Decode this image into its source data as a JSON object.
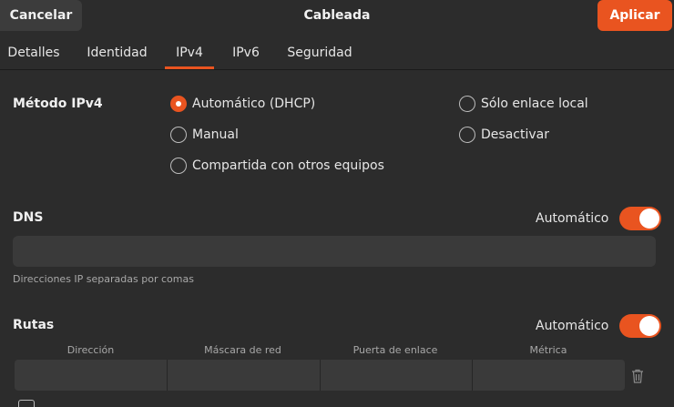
{
  "header": {
    "title": "Cableada",
    "cancel_label": "Cancelar",
    "apply_label": "Aplicar"
  },
  "tabs": [
    {
      "label": "Detalles"
    },
    {
      "label": "Identidad"
    },
    {
      "label": "IPv4"
    },
    {
      "label": "IPv6"
    },
    {
      "label": "Seguridad"
    }
  ],
  "active_tab": "IPv4",
  "ipv4": {
    "method_label": "Método IPv4",
    "methods": [
      {
        "label": "Automático (DHCP)",
        "selected": true
      },
      {
        "label": "Manual",
        "selected": false
      },
      {
        "label": "Compartida con otros equipos",
        "selected": false
      },
      {
        "label": "Sólo enlace local",
        "selected": false
      },
      {
        "label": "Desactivar",
        "selected": false
      }
    ]
  },
  "dns": {
    "label": "DNS",
    "auto_label": "Automático",
    "auto_on": true,
    "value": "",
    "hint": "Direcciones IP separadas por comas"
  },
  "routes": {
    "label": "Rutas",
    "auto_label": "Automático",
    "auto_on": true,
    "columns": [
      "Dirección",
      "Máscara de red",
      "Puerta de enlace",
      "Métrica"
    ]
  },
  "colors": {
    "accent": "#e95420",
    "background": "#2c2c2c",
    "input": "#3a3a3a"
  }
}
